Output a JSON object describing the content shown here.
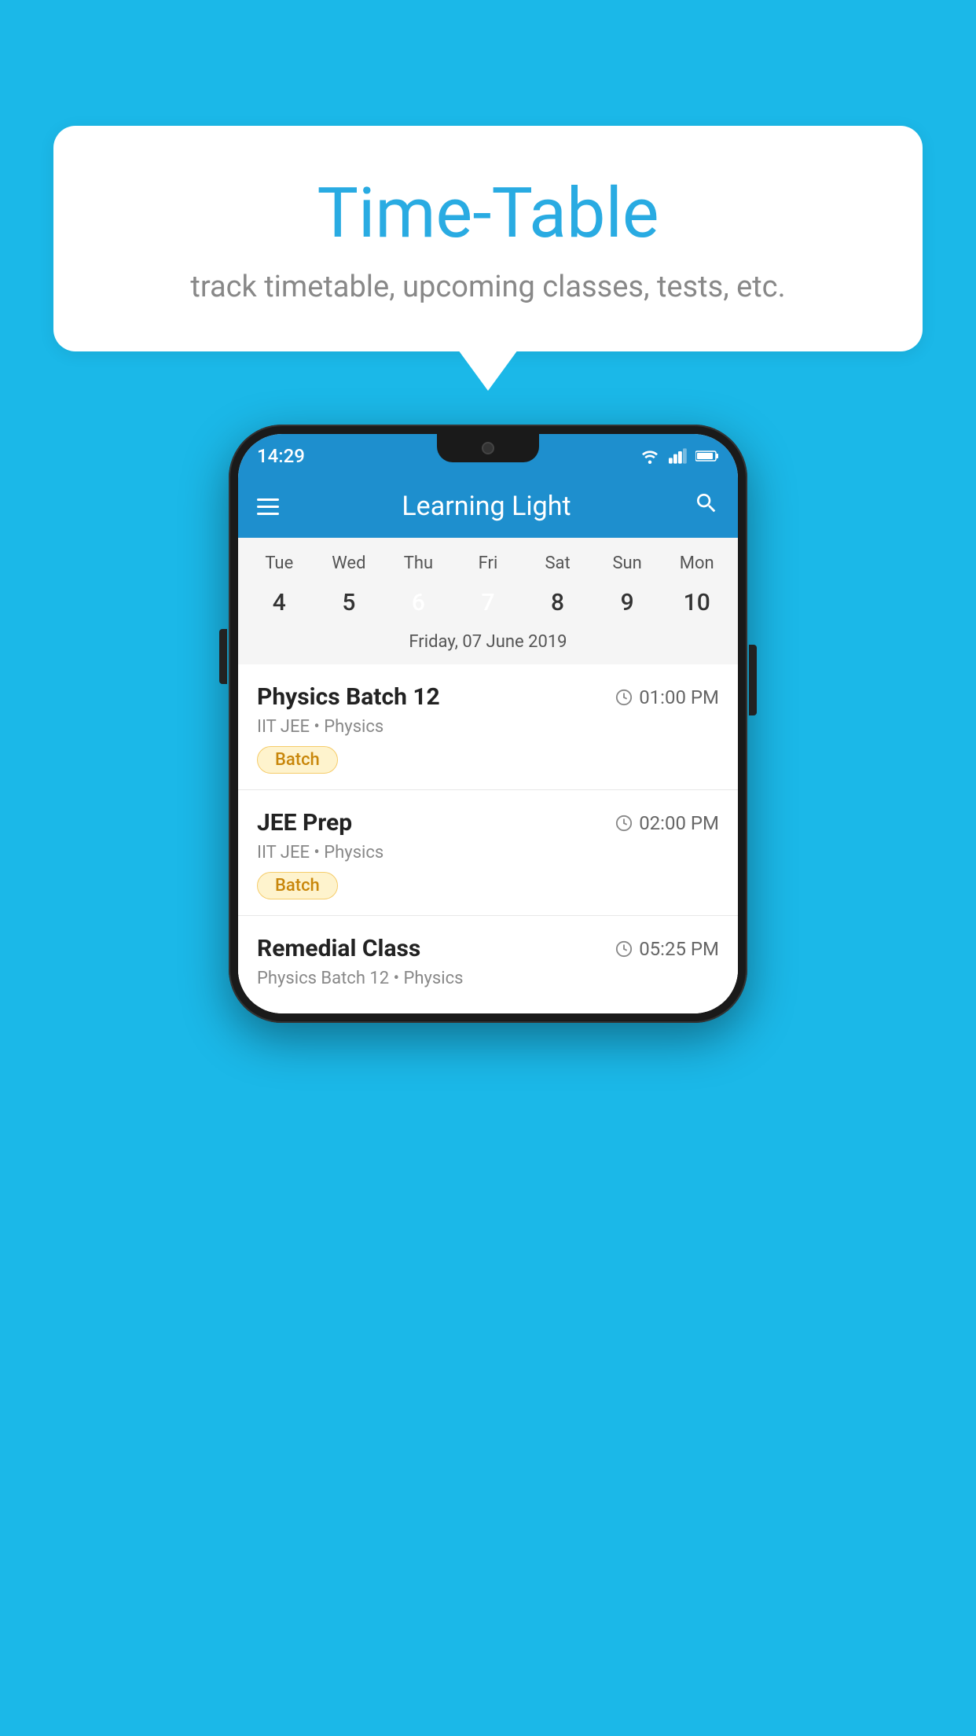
{
  "background_color": "#1bb8e8",
  "bubble": {
    "title": "Time-Table",
    "subtitle": "track timetable, upcoming classes, tests, etc."
  },
  "phone": {
    "status_bar": {
      "time": "14:29"
    },
    "header": {
      "title": "Learning Light"
    },
    "calendar": {
      "days": [
        {
          "name": "Tue",
          "num": "4",
          "state": "normal"
        },
        {
          "name": "Wed",
          "num": "5",
          "state": "normal"
        },
        {
          "name": "Thu",
          "num": "6",
          "state": "today"
        },
        {
          "name": "Fri",
          "num": "7",
          "state": "selected"
        },
        {
          "name": "Sat",
          "num": "8",
          "state": "normal"
        },
        {
          "name": "Sun",
          "num": "9",
          "state": "normal"
        },
        {
          "name": "Mon",
          "num": "10",
          "state": "normal"
        }
      ],
      "selected_date_label": "Friday, 07 June 2019"
    },
    "schedule": {
      "items": [
        {
          "title": "Physics Batch 12",
          "time": "01:00 PM",
          "subtitle": "IIT JEE • Physics",
          "tag": "Batch"
        },
        {
          "title": "JEE Prep",
          "time": "02:00 PM",
          "subtitle": "IIT JEE • Physics",
          "tag": "Batch"
        },
        {
          "title": "Remedial Class",
          "time": "05:25 PM",
          "subtitle": "Physics Batch 12 • Physics",
          "tag": null
        }
      ]
    }
  }
}
